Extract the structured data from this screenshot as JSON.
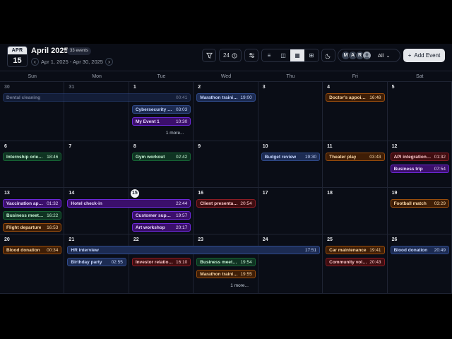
{
  "header": {
    "badge_month": "APR",
    "badge_day": "15",
    "title": "April 2025",
    "event_count": "33 events",
    "range": "Apr 1, 2025 - Apr 30, 2025",
    "prev_icon": "‹",
    "next_icon": "›",
    "hour_label": "24",
    "filter_label": "All",
    "filter_chevron": "⌄",
    "add_label": "Add Event",
    "add_icon": "+",
    "avatars": [
      "M",
      "A",
      "R"
    ],
    "icons": {
      "filter": "funnel-icon",
      "clock": "clock-icon",
      "settings": "sliders-icon",
      "moon": "moon-icon"
    },
    "view_icons": [
      "≡",
      "◫",
      "▦",
      "⊞"
    ]
  },
  "weekdays": [
    "Sun",
    "Mon",
    "Tue",
    "Wed",
    "Thu",
    "Fri",
    "Sat"
  ],
  "days": [
    {
      "n": "30",
      "muted": true
    },
    {
      "n": "31",
      "muted": true
    },
    {
      "n": "1"
    },
    {
      "n": "2"
    },
    {
      "n": "3"
    },
    {
      "n": "4"
    },
    {
      "n": "5"
    },
    {
      "n": "6"
    },
    {
      "n": "7"
    },
    {
      "n": "8"
    },
    {
      "n": "9"
    },
    {
      "n": "10"
    },
    {
      "n": "11"
    },
    {
      "n": "12"
    },
    {
      "n": "13"
    },
    {
      "n": "14"
    },
    {
      "n": "15",
      "today": true
    },
    {
      "n": "16"
    },
    {
      "n": "17"
    },
    {
      "n": "18"
    },
    {
      "n": "19"
    },
    {
      "n": "20"
    },
    {
      "n": "21"
    },
    {
      "n": "22"
    },
    {
      "n": "23"
    },
    {
      "n": "24"
    },
    {
      "n": "25"
    },
    {
      "n": "26"
    }
  ],
  "events": [
    {
      "week": 0,
      "col": 0,
      "span": 3,
      "slot": 0,
      "title": "Dental cleaning",
      "time": "00:41",
      "color": "blue",
      "faded": true
    },
    {
      "week": 0,
      "col": 3,
      "span": 1,
      "slot": 0,
      "title": "Marathon training",
      "time": "19:00",
      "color": "blue"
    },
    {
      "week": 0,
      "col": 5,
      "span": 1,
      "slot": 0,
      "title": "Doctor's appoint...",
      "time": "16:48",
      "color": "orange"
    },
    {
      "week": 0,
      "col": 2,
      "span": 1,
      "slot": 1,
      "title": "Cybersecurity audit",
      "time": "03:03",
      "color": "blue"
    },
    {
      "week": 0,
      "col": 2,
      "span": 1,
      "slot": 2,
      "title": "My Event 1",
      "time": "10:30",
      "color": "purple"
    },
    {
      "week": 1,
      "col": 0,
      "span": 1,
      "slot": 0,
      "title": "Internship orient...",
      "time": "18:46",
      "color": "green"
    },
    {
      "week": 1,
      "col": 2,
      "span": 1,
      "slot": 0,
      "title": "Gym workout",
      "time": "02:42",
      "color": "green"
    },
    {
      "week": 1,
      "col": 4,
      "span": 1,
      "slot": 0,
      "title": "Budget review",
      "time": "19:30",
      "color": "blue"
    },
    {
      "week": 1,
      "col": 5,
      "span": 1,
      "slot": 0,
      "title": "Theater play",
      "time": "03:43",
      "color": "orange"
    },
    {
      "week": 1,
      "col": 6,
      "span": 1,
      "slot": 0,
      "title": "API integration u...",
      "time": "01:32",
      "color": "red"
    },
    {
      "week": 1,
      "col": 6,
      "span": 1,
      "slot": 1,
      "title": "Business trip",
      "time": "07:54",
      "color": "purple"
    },
    {
      "week": 2,
      "col": 0,
      "span": 1,
      "slot": 0,
      "title": "Vaccination appoi...",
      "time": "01:32",
      "color": "purple"
    },
    {
      "week": 2,
      "col": 1,
      "span": 2,
      "slot": 0,
      "title": "Hotel check-in",
      "time": "22:44",
      "color": "purple"
    },
    {
      "week": 2,
      "col": 3,
      "span": 1,
      "slot": 0,
      "title": "Client presentation",
      "time": "20:54",
      "color": "red"
    },
    {
      "week": 2,
      "col": 6,
      "span": 1,
      "slot": 0,
      "title": "Football match",
      "time": "03:29",
      "color": "orange"
    },
    {
      "week": 2,
      "col": 0,
      "span": 1,
      "slot": 1,
      "title": "Business meeting",
      "time": "16:22",
      "color": "green"
    },
    {
      "week": 2,
      "col": 2,
      "span": 1,
      "slot": 1,
      "title": "Customer suppor...",
      "time": "19:57",
      "color": "purple"
    },
    {
      "week": 2,
      "col": 0,
      "span": 1,
      "slot": 2,
      "title": "Flight departure",
      "time": "16:53",
      "color": "orange"
    },
    {
      "week": 2,
      "col": 2,
      "span": 1,
      "slot": 2,
      "title": "Art workshop",
      "time": "20:17",
      "color": "purple"
    },
    {
      "week": 3,
      "col": 0,
      "span": 1,
      "slot": 0,
      "title": "Blood donation",
      "time": "00:34",
      "color": "orange"
    },
    {
      "week": 3,
      "col": 1,
      "span": 4,
      "slot": 0,
      "title": "HR interview",
      "time": "17:51",
      "color": "blue"
    },
    {
      "week": 3,
      "col": 5,
      "span": 1,
      "slot": 0,
      "title": "Car maintenance",
      "time": "19:41",
      "color": "orange"
    },
    {
      "week": 3,
      "col": 6,
      "span": 1,
      "slot": 0,
      "title": "Blood donation",
      "time": "20:49",
      "color": "blue"
    },
    {
      "week": 3,
      "col": 1,
      "span": 1,
      "slot": 1,
      "title": "Birthday party",
      "time": "02:55",
      "color": "blue"
    },
    {
      "week": 3,
      "col": 2,
      "span": 1,
      "slot": 1,
      "title": "Investor relations...",
      "time": "16:10",
      "color": "red"
    },
    {
      "week": 3,
      "col": 3,
      "span": 1,
      "slot": 1,
      "title": "Business meeting",
      "time": "19:54",
      "color": "green"
    },
    {
      "week": 3,
      "col": 5,
      "span": 1,
      "slot": 1,
      "title": "Community volu...",
      "time": "20:43",
      "color": "red"
    },
    {
      "week": 3,
      "col": 3,
      "span": 1,
      "slot": 2,
      "title": "Marathon training",
      "time": "19:55",
      "color": "orange"
    }
  ],
  "more": [
    {
      "week": 0,
      "col": 2,
      "slot": 3,
      "label": "1 more..."
    },
    {
      "week": 3,
      "col": 3,
      "slot": 3,
      "label": "1 more..."
    }
  ]
}
